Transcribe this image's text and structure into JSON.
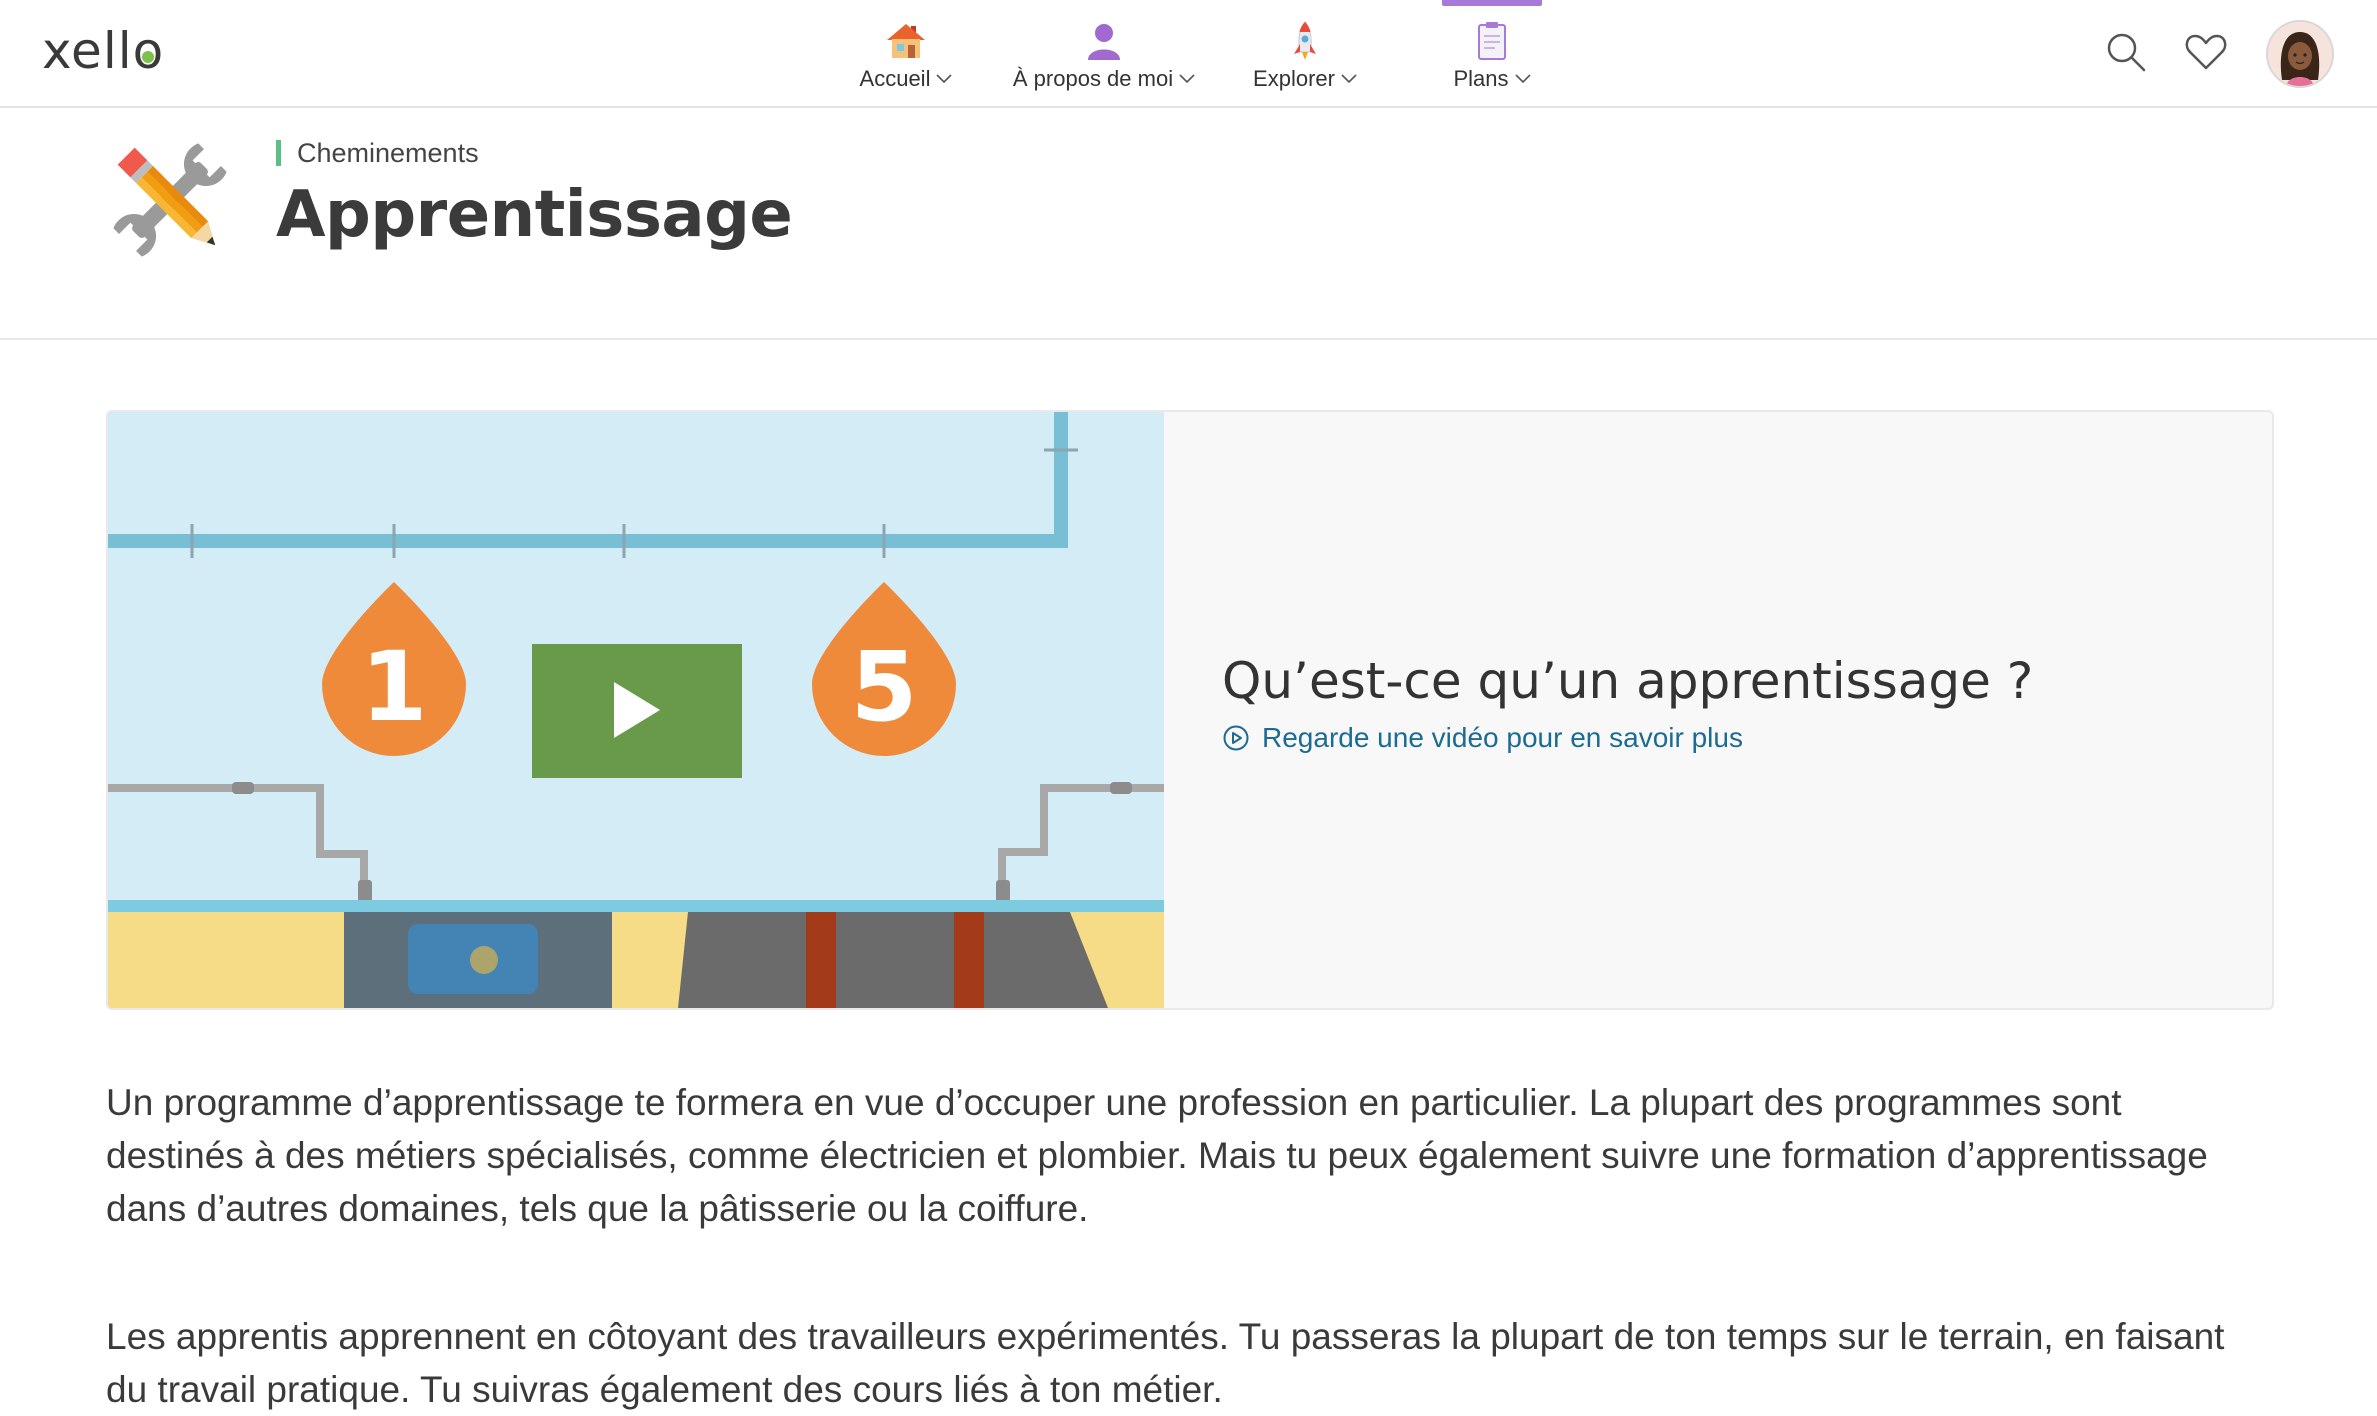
{
  "app": {
    "logo": "xello"
  },
  "nav": {
    "items": [
      {
        "label": "Accueil",
        "icon": "house-icon"
      },
      {
        "label": "À propos de moi",
        "icon": "person-icon"
      },
      {
        "label": "Explorer",
        "icon": "rocket-icon"
      },
      {
        "label": "Plans",
        "icon": "clipboard-icon",
        "active": true
      }
    ],
    "active_color": "#a67ad6",
    "right_icons": [
      "search-icon",
      "heart-icon",
      "avatar"
    ]
  },
  "header": {
    "breadcrumb": "Cheminements",
    "title": "Apprentissage",
    "icon": "wrench-pencil-icon",
    "breadcrumb_accent": "#5cbf85"
  },
  "video_card": {
    "title": "Qu’est-ce qu’un apprentissage ?",
    "link_label": "Regarde une vidéo pour en savoir plus",
    "link_color": "#1c6b93",
    "thumbnail": {
      "badges": [
        "1",
        "5"
      ],
      "play_icon": "play-icon",
      "play_color": "#689a49",
      "badge_color": "#ee8a3a"
    }
  },
  "body": {
    "paragraph_1": "Un programme d’apprentissage te formera en vue d’occuper une profession en particulier. La plupart des programmes sont destinés à des métiers spécialisés, comme électricien et plombier. Mais tu peux également suivre une formation d’apprentissage dans d’autres domaines, tels que la pâtisserie ou la coiffure.",
    "paragraph_2": "Les apprentis apprennent en côtoyant des travailleurs expérimentés. Tu passeras la plupart de ton temps sur le terrain, en faisant du travail pratique. Tu suivras également des cours liés à ton métier."
  }
}
